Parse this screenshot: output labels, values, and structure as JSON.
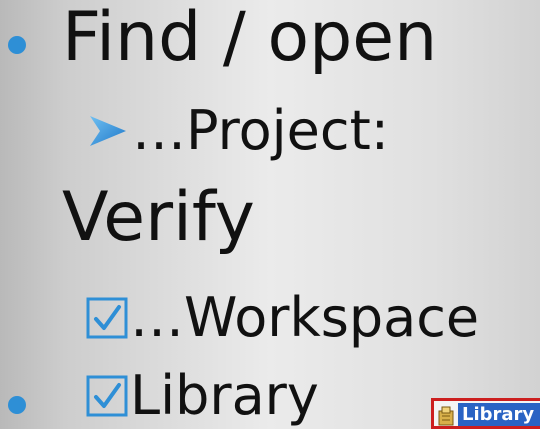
{
  "slide": {
    "item1": {
      "text": "Find / open"
    },
    "item1_sub": {
      "text": "…Project:"
    },
    "item2": {
      "text": "Verify"
    },
    "item2_sub1": {
      "text": "…Workspace"
    },
    "item2_sub2": {
      "text": "Library"
    },
    "library_chip": {
      "label": "Library",
      "icon": "library-icon"
    }
  },
  "colors": {
    "bullet": "#2e8fd6",
    "checkbox": "#2e8fd6",
    "chip_border": "#cc1f1f",
    "chip_label_bg": "#2a63c4"
  }
}
